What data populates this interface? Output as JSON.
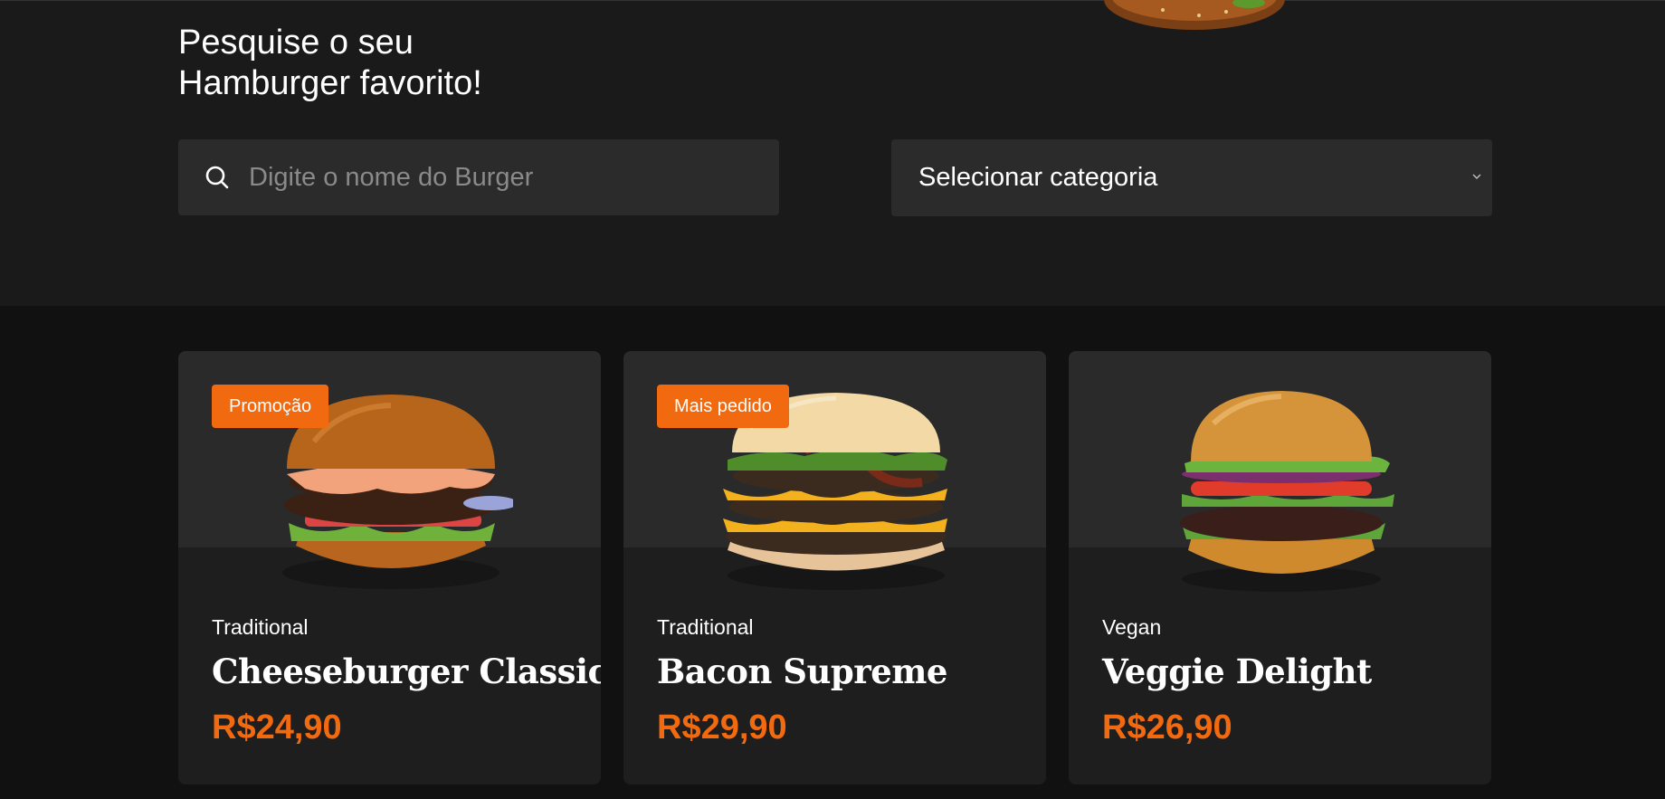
{
  "header": {
    "headline_line1": "Pesquise o seu",
    "headline_line2": "Hamburger favorito!"
  },
  "search": {
    "placeholder": "Digite o nome do Burger",
    "value": ""
  },
  "category_select": {
    "selected": "Selecionar categoria"
  },
  "colors": {
    "accent": "#f26a10",
    "background": "#111111",
    "panel": "#1a1a1a",
    "card": "#1e1e1e"
  },
  "products": [
    {
      "badge": "Promoção",
      "category": "Traditional",
      "name": "Cheeseburger Classic",
      "price": "R$24,90"
    },
    {
      "badge": "Mais pedido",
      "category": "Traditional",
      "name": "Bacon Supreme",
      "price": "R$29,90"
    },
    {
      "badge": "",
      "category": "Vegan",
      "name": "Veggie Delight",
      "price": "R$26,90"
    }
  ]
}
